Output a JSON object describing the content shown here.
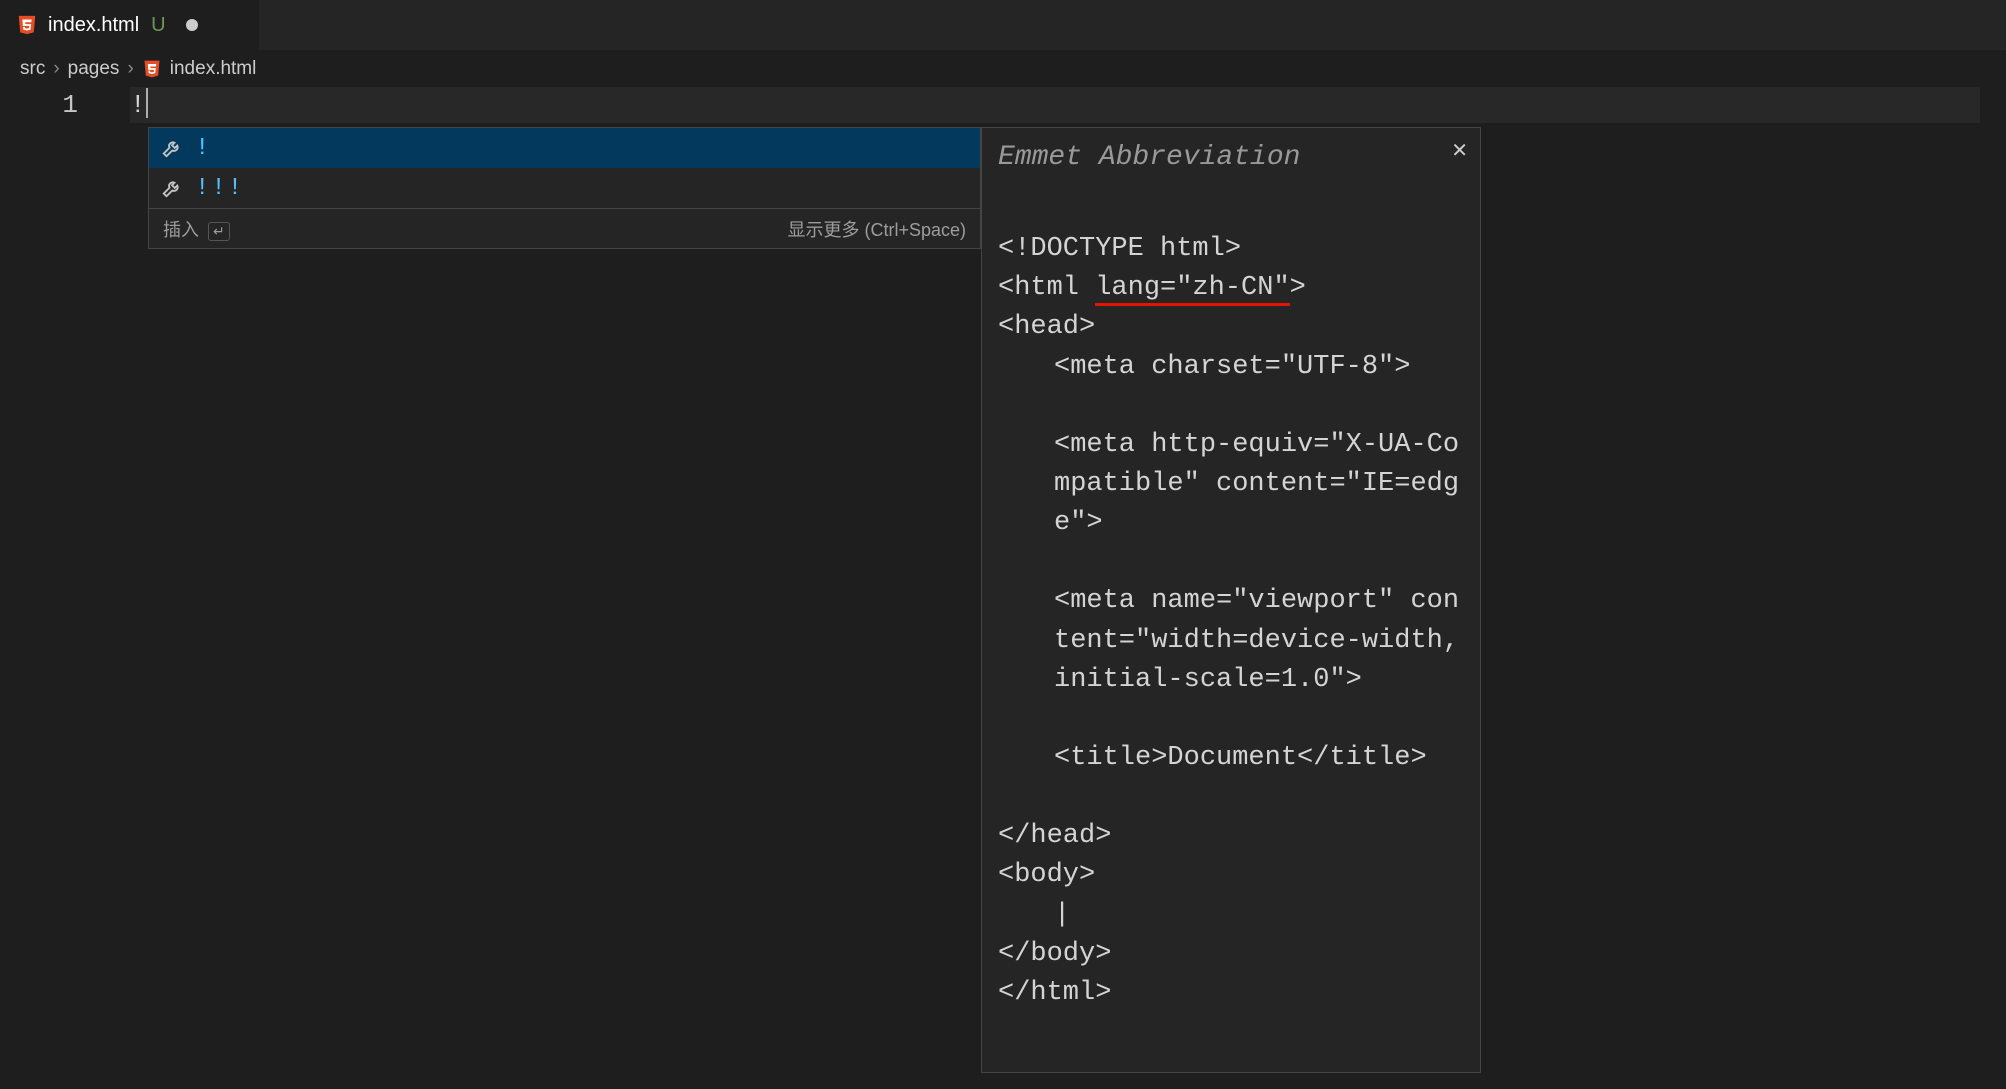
{
  "tab": {
    "filename": "index.html",
    "status": "U",
    "dirty": true
  },
  "breadcrumb": {
    "parts": [
      "src",
      "pages"
    ],
    "file": "index.html"
  },
  "editor": {
    "line_number": "1",
    "content": "!"
  },
  "suggestions": {
    "items": [
      {
        "label": "!",
        "selected": true
      },
      {
        "label": "!!!",
        "selected": false
      }
    ],
    "status_left": "插入",
    "status_left_key": "↵",
    "status_right": "显示更多 (Ctrl+Space)"
  },
  "doc": {
    "title": "Emmet Abbreviation",
    "lines": {
      "l1": "<!DOCTYPE html>",
      "l2a": "<html ",
      "l2b": "lang=\"zh-CN\"",
      "l2c": ">",
      "l3": "<head>",
      "l4": "<meta charset=\"UTF-8\">",
      "l5": "<meta http-equiv=\"X-UA-Compatible\" content=\"IE=edge\">",
      "l6": "<meta name=\"viewport\" content=\"width=device-width, initial-scale=1.0\">",
      "l7": "<title>Document</title>",
      "l8": "</head>",
      "l9": "<body>",
      "l10_cursor": "|",
      "l11": "</body>",
      "l12": "</html>"
    }
  }
}
